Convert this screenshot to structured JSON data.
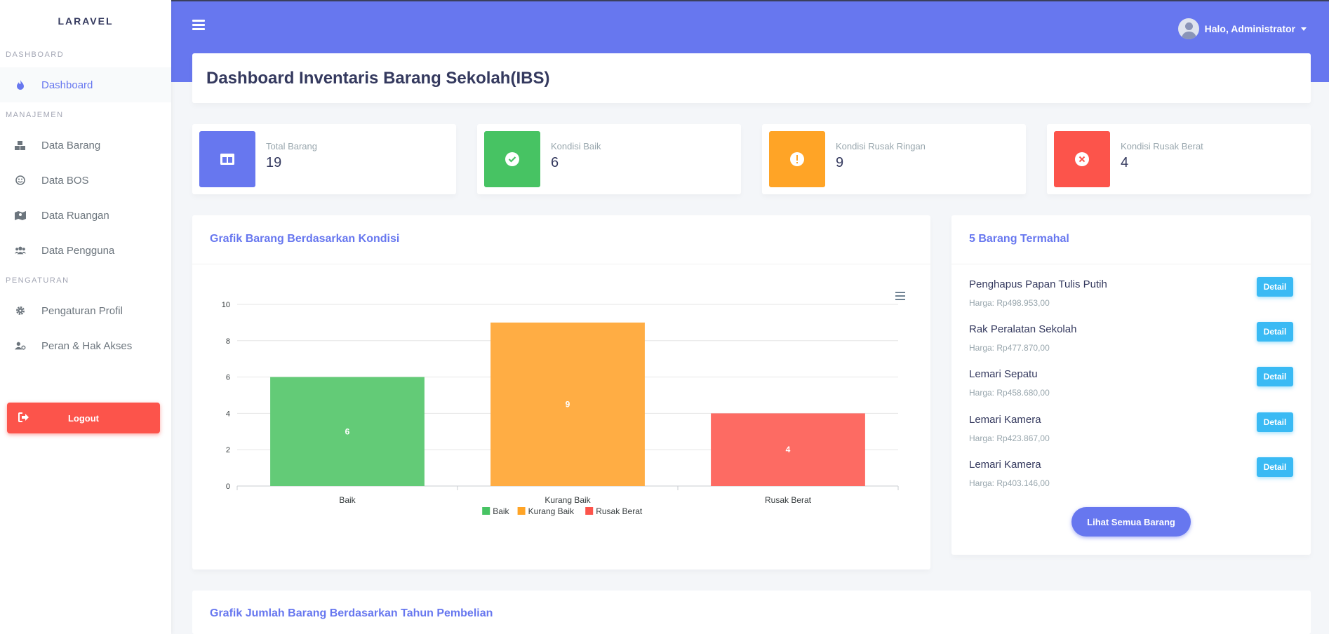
{
  "brand": "LARAVEL",
  "sidebar": {
    "sections": [
      {
        "header": "DASHBOARD",
        "items": [
          {
            "label": "Dashboard",
            "icon": "fire-icon",
            "active": true
          }
        ]
      },
      {
        "header": "MANAJEMEN",
        "items": [
          {
            "label": "Data Barang",
            "icon": "boxes-icon"
          },
          {
            "label": "Data BOS",
            "icon": "smile-icon"
          },
          {
            "label": "Data Ruangan",
            "icon": "map-icon"
          },
          {
            "label": "Data Pengguna",
            "icon": "users-icon"
          }
        ]
      },
      {
        "header": "PENGATURAN",
        "items": [
          {
            "label": "Pengaturan Profil",
            "icon": "gear-icon"
          },
          {
            "label": "Peran & Hak Akses",
            "icon": "user-cog-icon"
          }
        ]
      }
    ],
    "logout_label": "Logout"
  },
  "navbar": {
    "greeting": "Halo, Administrator"
  },
  "header": {
    "title": "Dashboard Inventaris Barang Sekolah(IBS)"
  },
  "stats": [
    {
      "label": "Total Barang",
      "value": "19",
      "color": "#6777ef",
      "icon": "table-icon"
    },
    {
      "label": "Kondisi Baik",
      "value": "6",
      "color": "#47c363",
      "icon": "check-circle-icon"
    },
    {
      "label": "Kondisi Rusak Ringan",
      "value": "9",
      "color": "#ffa426",
      "icon": "exclamation-circle-icon"
    },
    {
      "label": "Kondisi Rusak Berat",
      "value": "4",
      "color": "#fc544b",
      "icon": "times-circle-icon"
    }
  ],
  "chart_card": {
    "title": "Grafik Barang Berdasarkan Kondisi"
  },
  "chart_data": {
    "type": "bar",
    "categories": [
      "Baik",
      "Kurang Baik",
      "Rusak Berat"
    ],
    "values": [
      6,
      9,
      4
    ],
    "colors": [
      "#63cb77",
      "#ffad44",
      "#fd6b63"
    ],
    "legend": [
      "Baik",
      "Kurang Baik",
      "Rusak Berat"
    ],
    "legend_colors": [
      "#47c363",
      "#ffa426",
      "#fc544b"
    ],
    "legend_position": "bottom",
    "ylim": [
      0,
      10
    ],
    "yticks": [
      "0",
      "2",
      "4",
      "6",
      "8",
      "10"
    ],
    "grid": true
  },
  "top_items": {
    "title": "5 Barang Termahal",
    "items": [
      {
        "name": "Penghapus Papan Tulis Putih",
        "price": "Harga: Rp498.953,00"
      },
      {
        "name": "Rak Peralatan Sekolah",
        "price": "Harga: Rp477.870,00"
      },
      {
        "name": "Lemari Sepatu",
        "price": "Harga: Rp458.680,00"
      },
      {
        "name": "Lemari Kamera",
        "price": "Harga: Rp423.867,00"
      },
      {
        "name": "Lemari Kamera",
        "price": "Harga: Rp403.146,00"
      }
    ],
    "detail_label": "Detail",
    "see_all_label": "Lihat Semua Barang"
  },
  "bottom_card": {
    "title": "Grafik Jumlah Barang Berdasarkan Tahun Pembelian"
  }
}
